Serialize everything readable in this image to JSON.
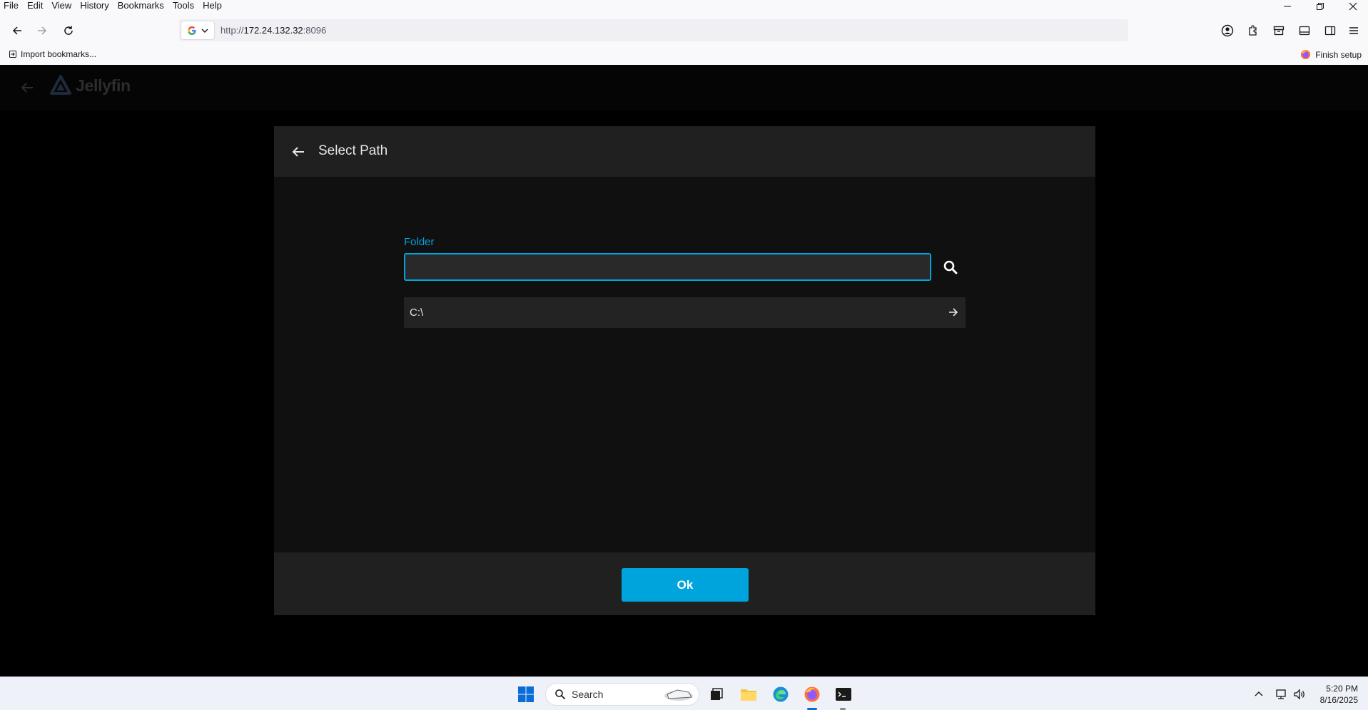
{
  "browser": {
    "menu": [
      "File",
      "Edit",
      "View",
      "History",
      "Bookmarks",
      "Tools",
      "Help"
    ],
    "url_scheme": "http://",
    "url_host": "172.24.132.32",
    "url_port": ":8096",
    "bookmarks_import": "Import bookmarks...",
    "finish_setup": "Finish setup"
  },
  "jellyfin": {
    "logo_text": "Jellyfin",
    "accent": "#00a4dc"
  },
  "dialog": {
    "title": "Select Path",
    "folder_label": "Folder",
    "folder_value": "",
    "paths": [
      {
        "label": "C:\\"
      }
    ],
    "ok_label": "Ok"
  },
  "taskbar": {
    "search_label": "Search",
    "time": "5:20 PM",
    "date": "8/16/2025"
  }
}
